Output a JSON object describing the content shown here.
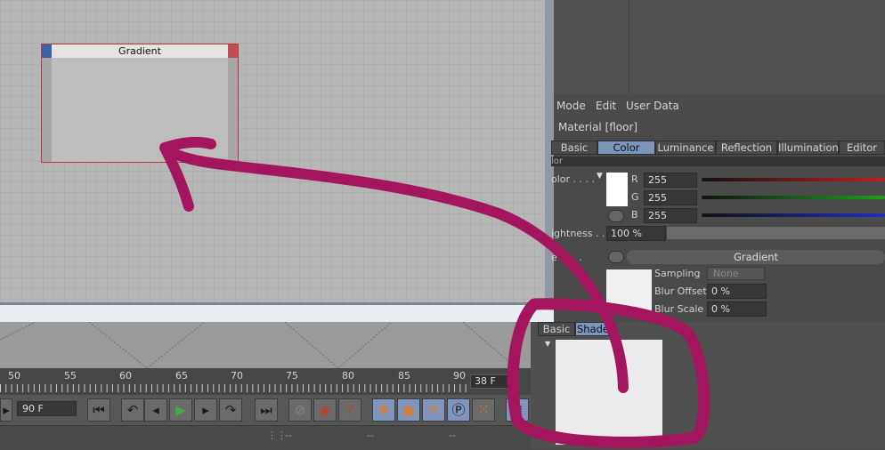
{
  "node_editor": {
    "node_title": "Gradient"
  },
  "timeline": {
    "ticks": [
      "50",
      "55",
      "60",
      "65",
      "70",
      "75",
      "80",
      "85",
      "90"
    ],
    "current_frame": "38 F",
    "fps": "90 F"
  },
  "transport": {
    "timecode": "--"
  },
  "attributes": {
    "menu": [
      "Mode",
      "Edit",
      "User Data"
    ],
    "material_title": "Material [floor]",
    "tabs": [
      "Basic",
      "Color",
      "Luminance",
      "Reflection",
      "Illumination",
      "Editor"
    ],
    "active_tab": "Color",
    "section_label": "lor",
    "color_label": "olor . . . .",
    "r_label": "R",
    "g_label": "G",
    "b_label": "B",
    "r_value": "255",
    "g_value": "255",
    "b_value": "255",
    "brightness_label": "ightness . .",
    "brightness_value": "100 %",
    "texture_label": "e . . . .",
    "texture_name": "Gradient",
    "sampling_label": "Sampling",
    "sampling_value": "None",
    "blur_offset_label": "Blur Offset",
    "blur_offset_value": "0 %",
    "blur_scale_label": "Blur Scale",
    "blur_scale_value": "0 %"
  },
  "material_manager": {
    "tabs": [
      "Basic",
      "Shade"
    ]
  },
  "colors": {
    "annotation": "#a3155c",
    "active_tab": "#7c96bb",
    "node_border": "#b33a3a"
  }
}
